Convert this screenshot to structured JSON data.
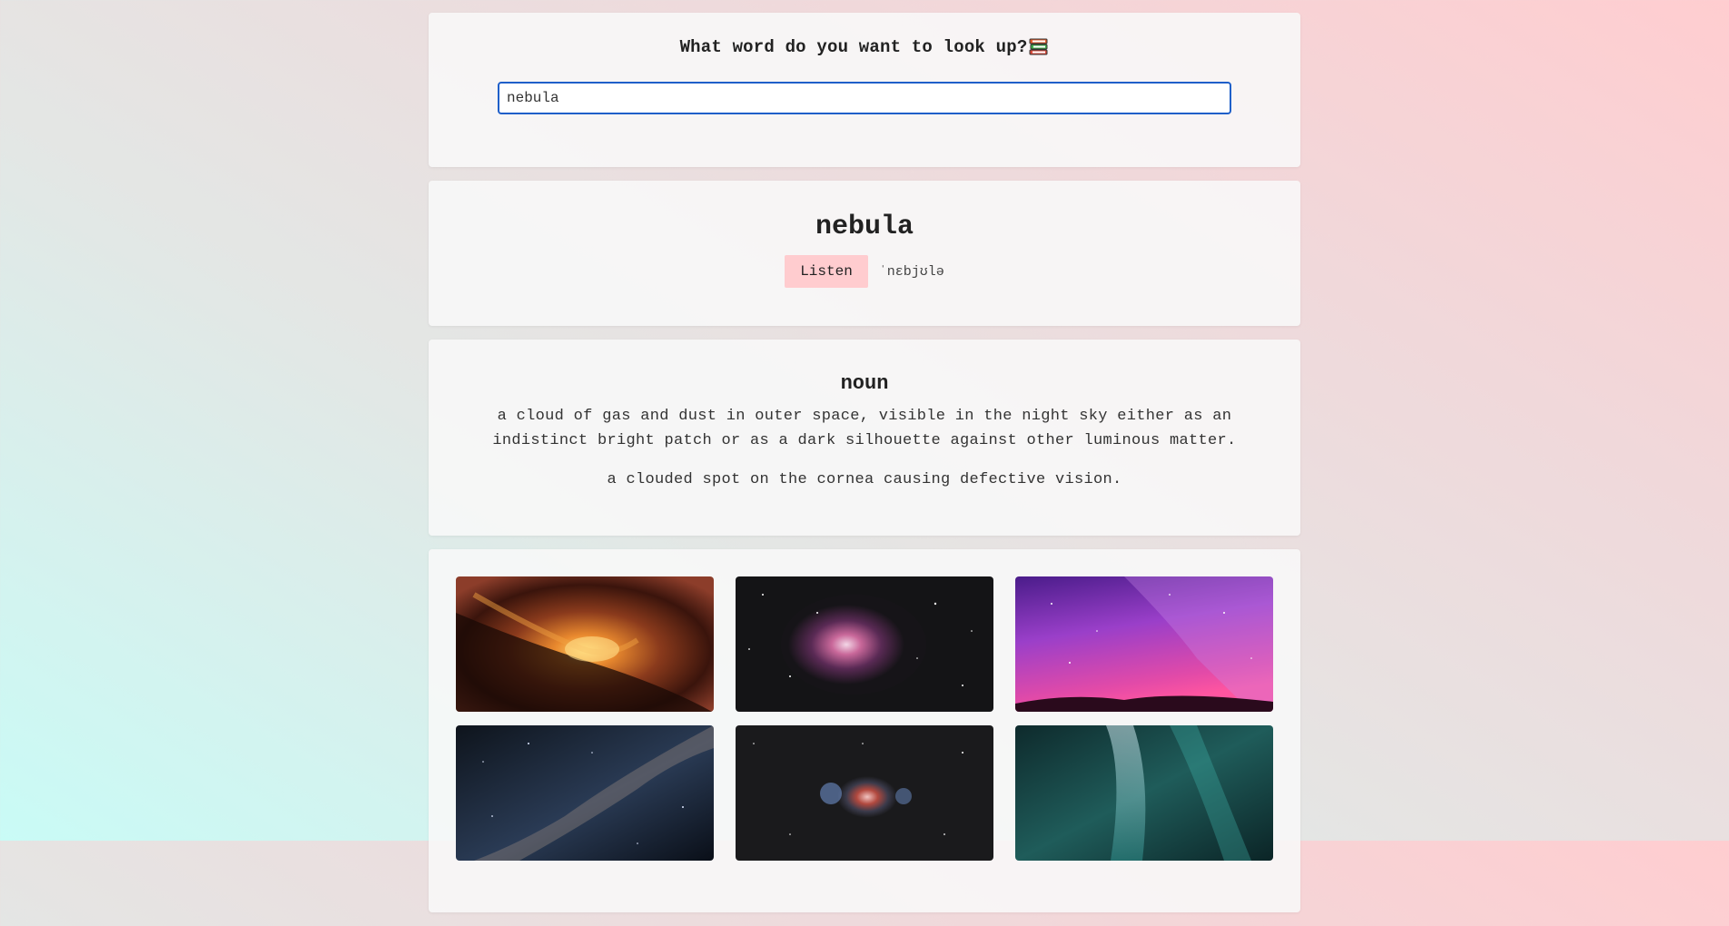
{
  "search": {
    "title": "What word do you want to look up?",
    "title_icon": "books-icon",
    "value": "nebula",
    "placeholder": ""
  },
  "word": {
    "text": "nebula",
    "listen_label": "Listen",
    "phonetic": "ˈnɛbjʊlə"
  },
  "meaning": {
    "part_of_speech": "noun",
    "definitions": [
      "a cloud of gas and dust in outer space, visible in the night sky either as an indistinct bright patch or as a dark silhouette against other luminous matter.",
      "a clouded spot on the cornea causing defective vision."
    ]
  },
  "images": [
    {
      "name": "image-orange-nebula"
    },
    {
      "name": "image-orion-nebula"
    },
    {
      "name": "image-purple-milky-way"
    },
    {
      "name": "image-milky-way-blue"
    },
    {
      "name": "image-orion-dark"
    },
    {
      "name": "image-aurora"
    }
  ],
  "colors": {
    "accent_border": "#1f5fc9",
    "listen_bg": "#ffcccf"
  }
}
